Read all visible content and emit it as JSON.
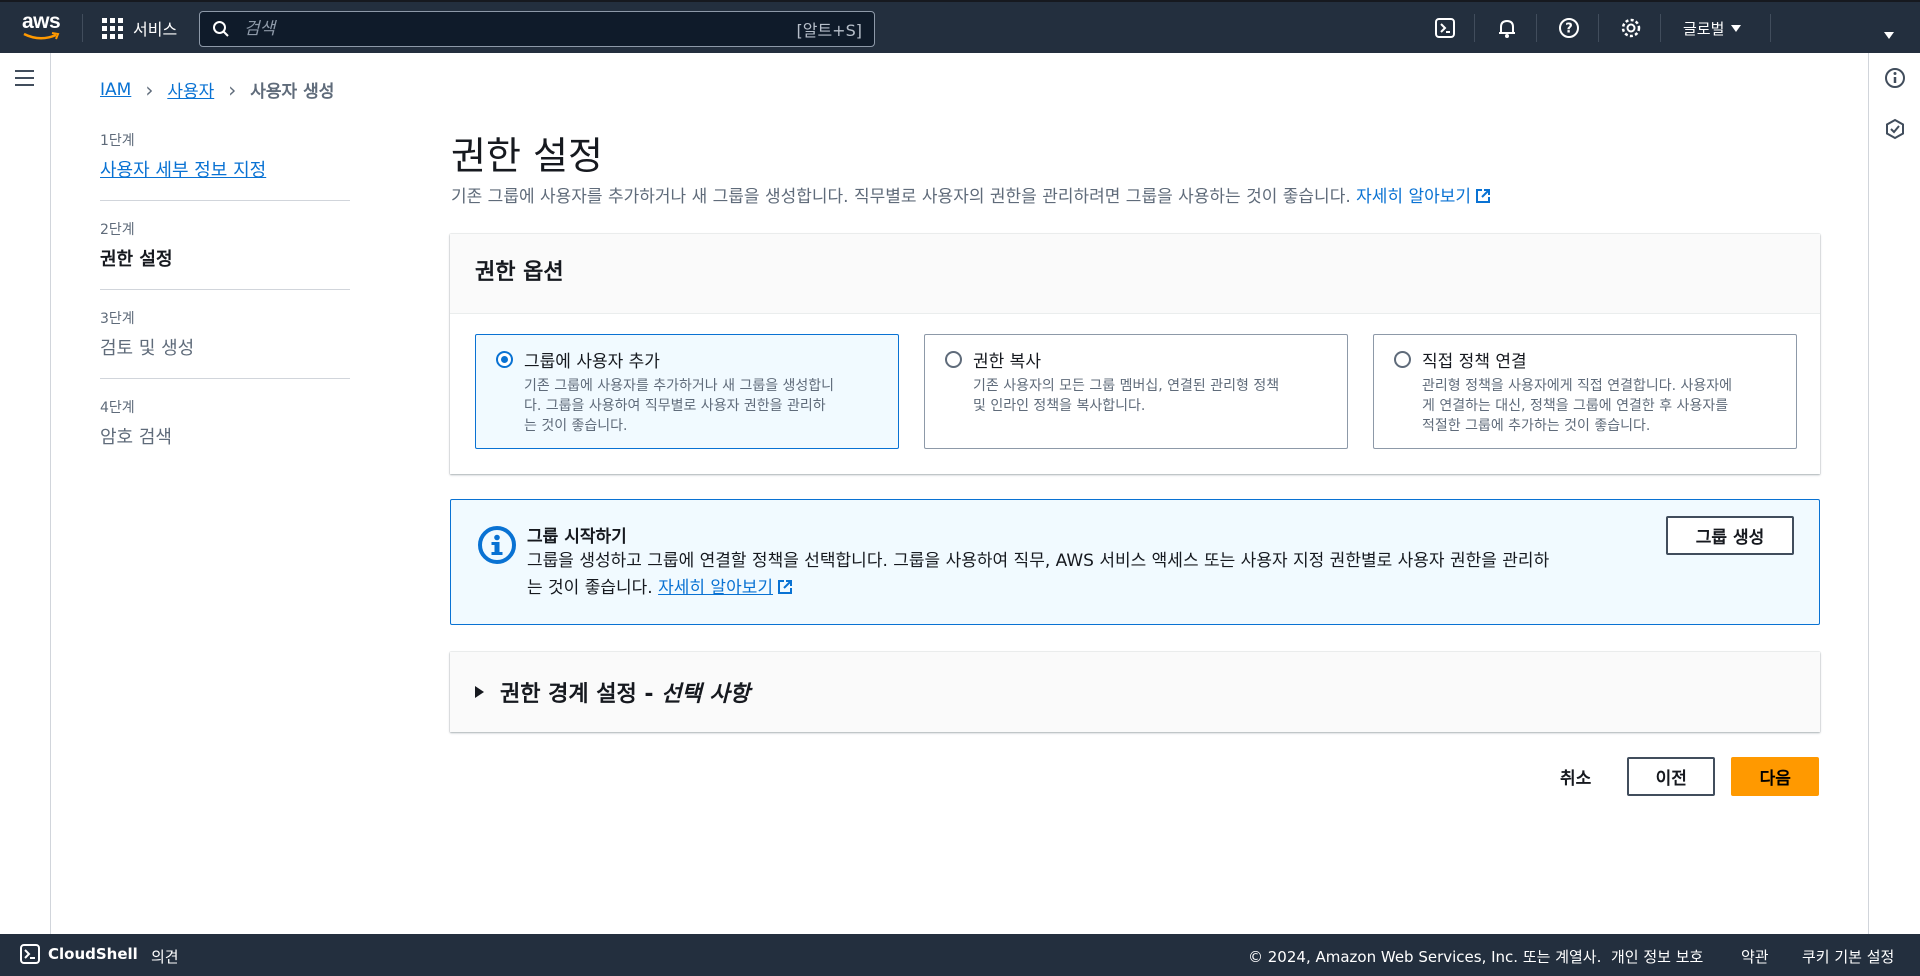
{
  "topnav": {
    "logo_text": "aws",
    "services_label": "서비스",
    "search_placeholder": "검색",
    "search_shortcut": "[알트+S]",
    "region_label": "글로벌",
    "accent_color": "#ff9900",
    "nav_bg": "#232f3e"
  },
  "breadcrumb": {
    "items": [
      "IAM",
      "사용자"
    ],
    "current": "사용자 생성"
  },
  "steps": [
    {
      "num": "1단계",
      "label": "사용자 세부 정보 지정"
    },
    {
      "num": "2단계",
      "label": "권한 설정"
    },
    {
      "num": "3단계",
      "label": "검토 및 생성"
    },
    {
      "num": "4단계",
      "label": "암호 검색"
    }
  ],
  "header": {
    "title": "권한 설정",
    "description": "기존 그룹에 사용자를 추가하거나 새 그룹을 생성합니다. 직무별로 사용자의 권한을 관리하려면 그룹을 사용하는 것이 좋습니다.",
    "learn_more": "자세히 알아보기"
  },
  "permission_options": {
    "title": "권한 옵션",
    "options": [
      {
        "title": "그룹에 사용자 추가",
        "desc_lines": [
          "기존 그룹에 사용자를 추가하거나 새 그룹을 생성합니",
          "다. 그룹을 사용하여 직무별로 사용자 권한을 관리하",
          "는 것이 좋습니다."
        ],
        "selected": true
      },
      {
        "title": "권한 복사",
        "desc_lines": [
          "기존 사용자의 모든 그룹 멤버십, 연결된 관리형 정책",
          "및 인라인 정책을 복사합니다."
        ],
        "selected": false
      },
      {
        "title": "직접 정책 연결",
        "desc_lines": [
          "관리형 정책을 사용자에게 직접 연결합니다. 사용자에",
          "게 연결하는 대신, 정책을 그룹에 연결한 후 사용자를",
          "적절한 그룹에 추가하는 것이 좋습니다."
        ],
        "selected": false
      }
    ]
  },
  "info_alert": {
    "title": "그룹 시작하기",
    "body_line1": "그룹을 생성하고 그룹에 연결할 정책을 선택합니다. 그룹을 사용하여 직무, AWS 서비스 액세스 또는 사용자 지정 권한별로 사용자 권한을 관리하",
    "body_line2": "는 것이 좋습니다.",
    "learn_more": "자세히 알아보기",
    "button_label": "그룹 생성"
  },
  "boundary": {
    "title": "권한 경계 설정 - ",
    "optional": "선택 사항"
  },
  "actions": {
    "cancel": "취소",
    "previous": "이전",
    "next": "다음"
  },
  "footer": {
    "cloudshell": "CloudShell",
    "feedback": "의견",
    "copyright": "© 2024, Amazon Web Services, Inc. 또는 계열사.",
    "privacy": "개인 정보 보호",
    "terms": "약관",
    "cookies": "쿠키 기본 설정"
  }
}
